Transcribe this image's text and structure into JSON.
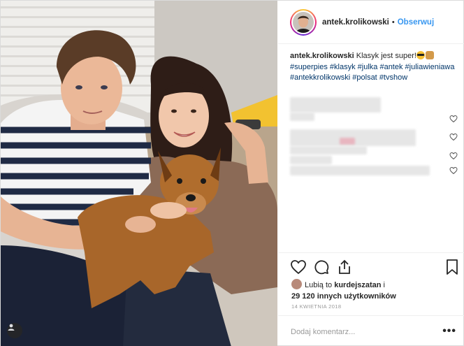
{
  "post": {
    "username": "antek.krolikowski",
    "follow_label": "Obserwuj",
    "header_separator": "•",
    "caption": {
      "username": "antek.krolikowski",
      "text": "Klasyk jest super!",
      "emojis": [
        "sunglasses-emoji",
        "dog-emoji"
      ],
      "hashtags": [
        "#superpies",
        "#klasyk",
        "#julka",
        "#antek",
        "#juliawieniawa",
        "#antekkrolikowski",
        "#polsat",
        "#tvshow"
      ]
    },
    "likes": {
      "prefix": "Lubią to",
      "liker": "kurdejszatan",
      "connector": "i",
      "count_text": "29 120 innych użytkowników"
    },
    "date": "14 kwietnia 2018",
    "comment_placeholder": "Dodaj komentarz...",
    "more_label": "•••"
  },
  "icons": [
    "heart-icon",
    "comment-icon",
    "share-icon",
    "bookmark-icon",
    "user-tag-icon"
  ],
  "colors": {
    "link_blue": "#3897f0",
    "hashtag": "#003569",
    "text": "#262626",
    "muted": "#999999",
    "border": "#efefef"
  }
}
